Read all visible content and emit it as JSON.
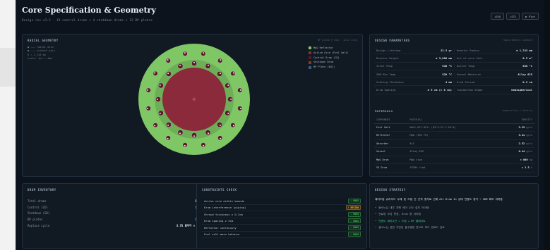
{
  "header": {
    "title": "Core Specification & Geometry",
    "subtitle": "Design rev v3.2 · 19 control drums + 4 shutdown drums + 12 BP plates",
    "buttons": [
      "↓SVG",
      "↓STL",
      "▶ Plot"
    ]
  },
  "radial": {
    "title": "RADIAL GEOMETRY",
    "note": "BP plane @ mid · plan view",
    "axis_notes": [
      "● ——— radial axis",
      "● ——— azimuth axis",
      "R = 1,743 mm",
      "scale: 1px = 4mm"
    ],
    "legend": [
      {
        "label": "MgO Reflector",
        "color": "#7fc765"
      },
      {
        "label": "Active Core (Fuel Salt)",
        "color": "#8a2a3a"
      },
      {
        "label": "Control Drum (CD)",
        "color": "#5b1a28"
      },
      {
        "label": "Shutdown Drum",
        "color": "#8a3a20"
      },
      {
        "label": "BP Plate (B4C)",
        "color": "#3a5a8a"
      }
    ],
    "colors": {
      "reflector": "#7fc765",
      "core": "#8a2a3a",
      "drum": "#5b1a28"
    }
  },
  "params": {
    "title": "DESIGN PARAMETERS",
    "note": "requirements summary",
    "rows": [
      [
        {
          "label": "Design Lifetime",
          "value": "22.5 yr"
        },
        {
          "label": "Reactor Radius",
          "value": "≤ 1,743 mm"
        }
      ],
      [
        {
          "label": "Reactor Height",
          "value": "≤ 3,886 mm"
        },
        {
          "label": "Out-of-core Salt",
          "value": "6.5 m³"
        }
      ],
      [
        {
          "label": "Inlet Temp",
          "value": "540 °C"
        },
        {
          "label": "Outlet Temp",
          "value": "630 °C"
        }
      ],
      [
        {
          "label": "SDM Min Temp",
          "value": "520 °C"
        },
        {
          "label": "Vessel Material",
          "value": "Alloy 625"
        }
      ],
      [
        {
          "label": "Coating Thickness",
          "value": "4 mm"
        },
        {
          "label": "Drum Shroud",
          "value": "0.2 cm"
        }
      ],
      [
        {
          "label": "Drum Spacing",
          "value": "≥ 5 cm (≈ 6 cm)"
        },
        {
          "label": "Top/Bottom Shape",
          "value": "hemispherical"
        }
      ]
    ]
  },
  "materials": {
    "title": "MATERIALS",
    "note": "composition / density",
    "headers": [
      "COMPONENT",
      "MATERIAL",
      "DENSITY"
    ],
    "rows": [
      {
        "component": "Fuel Salt",
        "material": "NaCl-UCl-UCl₃ (43.3-21.7-35.0)",
        "density": "3.29",
        "unit": "g/cc"
      },
      {
        "component": "Reflector",
        "material": "MgO (TDS 75)",
        "density": "3.41",
        "unit": "g/cc"
      },
      {
        "component": "Absorber",
        "material": "B₄C",
        "density": "2.52",
        "unit": "g/cc"
      },
      {
        "component": "Vessel",
        "material": "Alloy 625",
        "density": "8.44",
        "unit": "g/cc"
      },
      {
        "component": "MgO Drum",
        "material": "MgO clad",
        "density": "≈ 800",
        "unit": "kg"
      },
      {
        "component": "SS Drum",
        "material": "SS304 clad",
        "density": "≈ 1.3",
        "unit": "t"
      }
    ]
  },
  "inventory": {
    "title": "DRUM INVENTORY",
    "rows": [
      {
        "label": "Total drums",
        "value": "16",
        "color": "#e6ebf2"
      },
      {
        "label": "Control (CD)",
        "value": "10",
        "color": "#3ccf8e"
      },
      {
        "label": "Shutdown (SD)",
        "value": "6",
        "color": "#f0b83a"
      },
      {
        "label": "BP plates",
        "value": "12",
        "color": "#6fa8ff"
      },
      {
        "label": "Replace cycle",
        "value": "3.75 EFPY × 4",
        "color": "#e6ebf2"
      }
    ]
  },
  "constraints": {
    "title": "CONSTRAINTS CHECK",
    "rows": [
      {
        "label": "Active core within bounds",
        "status": "✓ PASS",
        "kind": "pass"
      },
      {
        "label": "Drum interference (piping)",
        "status": "! REVIEW",
        "kind": "review"
      },
      {
        "label": "Shroud thickness ≥ 0.2cm",
        "status": "✓ PASS",
        "kind": "pass"
      },
      {
        "label": "Drum spacing ≥ 5cm",
        "status": "✓ PASS",
        "kind": "pass"
      },
      {
        "label": "Reflector continuity",
        "status": "✓ PASS",
        "kind": "pass"
      },
      {
        "label": "Fuel salt mass balance",
        "status": "✓ PASS",
        "kind": "pass"
      }
    ]
  },
  "strategy": {
    "title": "DESIGN STRATEGY",
    "lead": "제어드럼 슈라우드 두께 및 드럼 간 간격 증가로 인해 All Drum In 상태 반응도 증가 → SDM 확보 어려움",
    "items": [
      {
        "text": "붕소노심 내부 차폐 제어 수단 설치 아이템",
        "highlight": false
      },
      {
        "text": "연료염 조성 변경, Drum 형 아이템",
        "highlight": false
      },
      {
        "text": "반응도 제어수단 = 드럼 + BP 플레이트",
        "highlight": true
      },
      {
        "text": "붕소노심 표면 가연성 흡수봉형 판으로 하드 연료드 검토",
        "highlight": false
      }
    ]
  }
}
